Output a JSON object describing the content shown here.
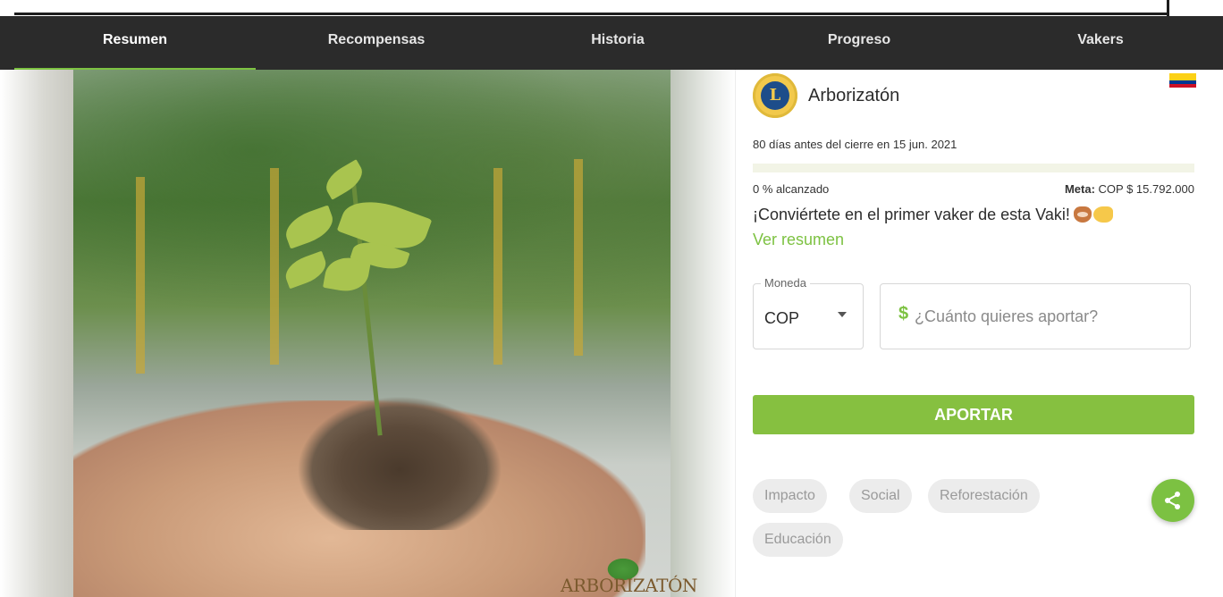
{
  "nav": {
    "tabs": [
      {
        "label": "Resumen",
        "active": true
      },
      {
        "label": "Recompensas",
        "active": false
      },
      {
        "label": "Historia",
        "active": false
      },
      {
        "label": "Progreso",
        "active": false
      },
      {
        "label": "Vakers",
        "active": false
      }
    ]
  },
  "hero": {
    "logo_text": "ARBORIZATÓN"
  },
  "campaign": {
    "name": "Arborizatón",
    "org_logo_letter": "L",
    "flag": "colombia-flag",
    "deadline": "80 días antes del cierre en 15 jun. 2021",
    "progress_percent": 0,
    "reached_text": "0 % alcanzado",
    "goal_label": "Meta:",
    "goal_value": "COP $ 15.792.000",
    "cta_text": "¡Conviértete en el primer vaker de esta Vaki!",
    "summary_link": "Ver resumen"
  },
  "contribution": {
    "currency_label": "Moneda",
    "currency_value": "COP",
    "amount_symbol": "$",
    "amount_placeholder": "¿Cuánto quieres aportar?",
    "submit_label": "APORTAR"
  },
  "tags": [
    "Impacto",
    "Social",
    "Reforestación",
    "Educación"
  ],
  "colors": {
    "accent": "#7dc242",
    "navbar": "#2b2b2b"
  }
}
